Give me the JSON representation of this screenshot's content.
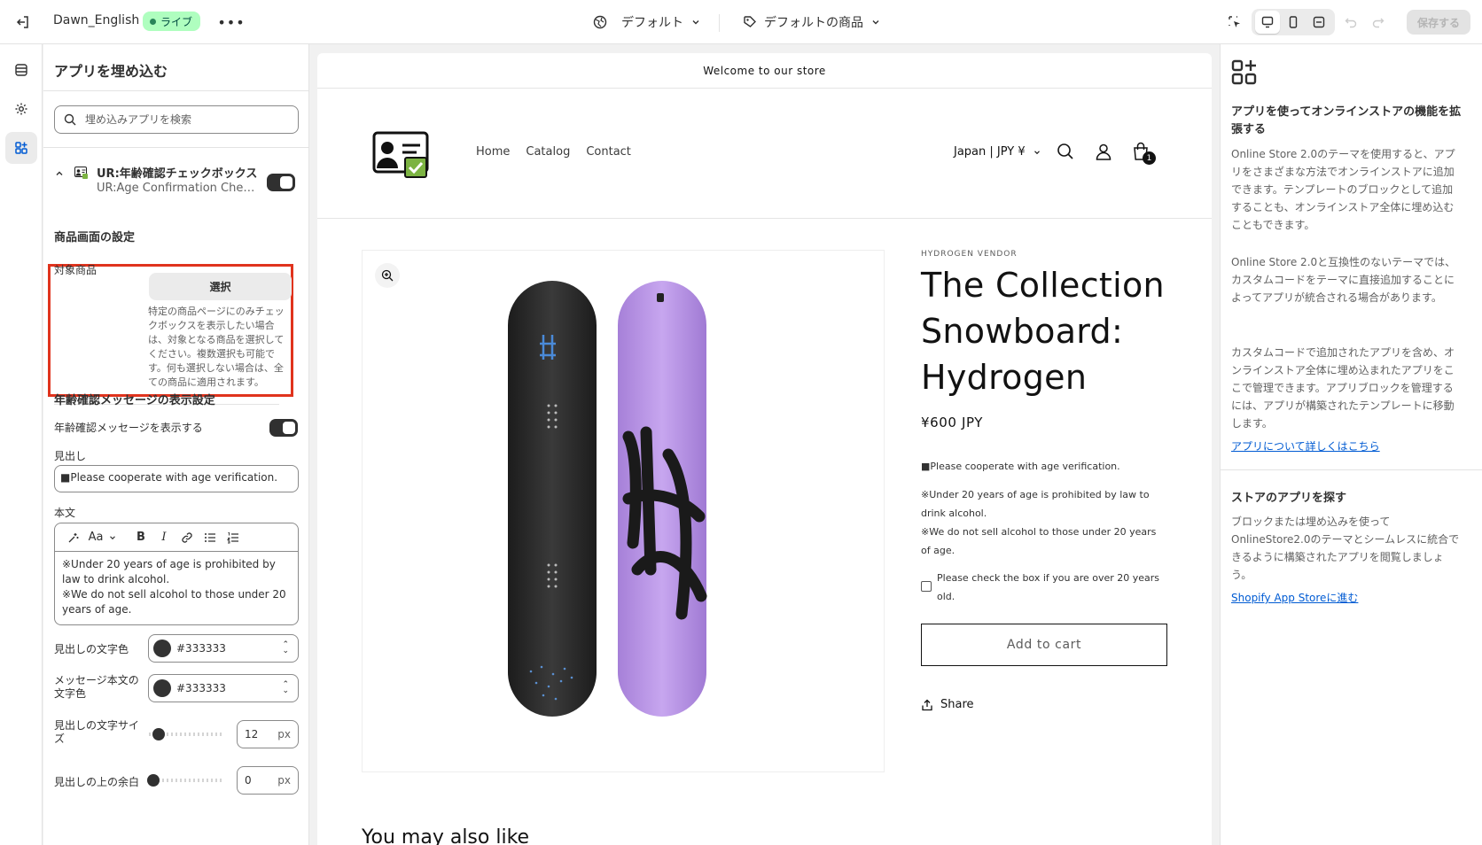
{
  "topbar": {
    "theme_name": "Dawn_English",
    "status_badge": "ライブ",
    "viewport_selector": "デフォルト",
    "template_selector": "デフォルトの商品",
    "save_label": "保存する"
  },
  "panel": {
    "title": "アプリを埋め込む",
    "search_placeholder": "埋め込みアプリを検索",
    "app": {
      "name": "UR:年齢確認チェックボックス",
      "subtitle": "UR:Age Confirmation Checkbox",
      "enabled": true
    },
    "product_settings_heading": "商品画面の設定",
    "target_label": "対象商品",
    "select_label": "選択",
    "target_help": "特定の商品ページにのみチェックボックスを表示したい場合は、対象となる商品を選択してください。複数選択も可能です。何も選択しない場合は、全ての商品に適用されます。",
    "message_settings_heading": "年齢確認メッセージの表示設定",
    "show_message_label": "年齢確認メッセージを表示する",
    "show_message_enabled": true,
    "heading_label": "見出し",
    "heading_value": "■Please cooperate with age verification.",
    "body_label": "本文",
    "rte": {
      "font_label": "Aa",
      "bold": "B",
      "italic": "I"
    },
    "body_lines": [
      "※Under 20 years of age is prohibited by law to drink alcohol.",
      "※We do not sell alcohol to those under 20 years of age."
    ],
    "heading_color_label": "見出しの文字色",
    "heading_color_value": "#333333",
    "message_color_label": "メッセージ本文の文字色",
    "message_color_value": "#333333",
    "heading_size_label": "見出しの文字サイズ",
    "heading_size_value": "12",
    "heading_size_unit": "px",
    "heading_size_fraction": 0.08,
    "top_margin_label": "見出しの上の余白",
    "top_margin_value": "0",
    "top_margin_unit": "px",
    "top_margin_fraction": 0.0
  },
  "preview": {
    "announcement": "Welcome to our store",
    "nav": [
      "Home",
      "Catalog",
      "Contact"
    ],
    "currency": "Japan | JPY ¥",
    "cart_count": "1",
    "vendor": "HYDROGEN VENDOR",
    "product_title": "The Collection Snowboard: Hydrogen",
    "price": "¥600 JPY",
    "msg_heading": "■Please cooperate with age verification.",
    "msg_line1": "※Under 20 years of age is prohibited by law to drink alcohol.",
    "msg_line2": "※We do not sell alcohol to those under 20 years of age.",
    "checkbox_label": "Please check the box if you are over 20 years old.",
    "add_to_cart": "Add to cart",
    "share": "Share",
    "next_section_title": "You may also like"
  },
  "info": {
    "heading1": "アプリを使ってオンラインストアの機能を拡張する",
    "para1": "Online Store 2.0のテーマを使用すると、アプリをさまざまな方法でオンラインストアに追加できます。テンプレートのブロックとして追加することも、オンラインストア全体に埋め込むこともできます。",
    "para2": "Online Store 2.0と互換性のないテーマでは、カスタムコードをテーマに直接追加することによってアプリが統合される場合があります。",
    "para3": "カスタムコードで追加されたアプリを含め、オンラインストア全体に埋め込まれたアプリをここで管理できます。アプリブロックを管理するには、アプリが構築されたテンプレートに移動します。",
    "link1": "アプリについて詳しくはこちら",
    "heading2": "ストアのアプリを探す",
    "para4": "ブロックまたは埋め込みを使ってOnlineStore2.0のテーマとシームレスに統合できるように構築されたアプリを閲覧しましょう。",
    "link2": "Shopify App Storeに進む"
  },
  "colors": {
    "accent_red": "#e0331d",
    "badge_bg": "#affebf",
    "link": "#005bd3",
    "board_purple": "#b48ee0",
    "board_black": "#2a2a2a"
  }
}
